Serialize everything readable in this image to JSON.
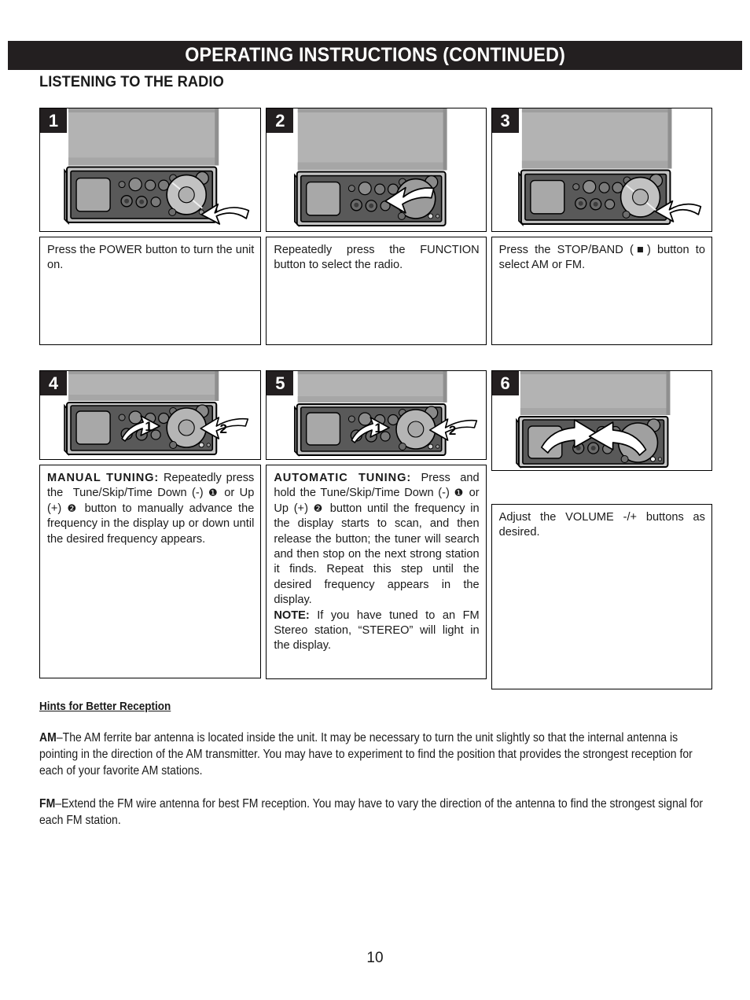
{
  "header": {
    "title": "OPERATING INSTRUCTIONS (CONTINUED)"
  },
  "section": {
    "heading": "LISTENING TO THE RADIO"
  },
  "steps": [
    {
      "number": "1",
      "figure": "stereo-front-panel-power-arrow",
      "text_plain": "Press the POWER button to turn the unit on.",
      "text_html": "Press the POWER button to turn the unit on."
    },
    {
      "number": "2",
      "figure": "stereo-front-panel-function-arrow",
      "text_plain": "Repeatedly press the FUNCTION button to select the radio.",
      "text_html": "Repeatedly press the FUNCTION button to select the radio."
    },
    {
      "number": "3",
      "figure": "stereo-front-panel-stop-band-arrow",
      "text_plain": "Press the STOP/BAND (■) button to select AM or FM.",
      "text_html": "Press the STOP/BAND (■) button to select AM or FM."
    },
    {
      "number": "4",
      "figure": "stereo-front-panel-tune-arrows-1-2",
      "text_plain": "MANUAL TUNING: Repeatedly press the  Tune/Skip/Time Down (-) ❶ or Up (+) ❷ button to manually advance the frequency in the display up or down until the desired frequency appears.",
      "text_html": "<b class=\"wide\">MANUAL TUNING:</b> Repeatedly press the&nbsp; Tune/Skip/Time Down (-) <span class=\"circ-num\">❶</span> or Up (+) <span class=\"circ-num\">❷</span> button to manually advance the frequency in the display up or down until the desired frequency appears."
    },
    {
      "number": "5",
      "figure": "stereo-front-panel-tune-arrows-1-2",
      "text_plain": "AUTOMATIC TUNING: Press and hold the Tune/Skip/Time Down (-) ❶ or Up (+) ❷ button until the frequency in the display starts to scan, and then release the button; the tuner will search and then stop on the next strong station it finds. Repeat this step until the desired frequency appears in the display. NOTE: If you have tuned to an FM Stereo station, “STEREO” will light in the display.",
      "text_html": "<b class=\"wide\">AUTOMATIC TUNING:</b> Press and hold the Tune/Skip/Time Down (-) <span class=\"circ-num\">❶</span> or Up (+) <span class=\"circ-num\">❷</span> button until the frequency in the display starts to scan, and then release the button; the tuner will search and then stop on the next strong station it finds. Repeat this step until the desired frequency appears in the display.<br><b>NOTE:</b> If you have tuned to an FM Stereo station, “STEREO” will light in the display."
    },
    {
      "number": "6",
      "figure": "stereo-front-panel-volume-arrows",
      "text_plain": "Adjust the VOLUME -/+ buttons as desired.",
      "text_html": "Adjust the VOLUME -/+ buttons as desired."
    }
  ],
  "hints": {
    "title": "Hints for Better Reception",
    "paragraphs": [
      {
        "label": "AM",
        "text_html": "<b>AM</b>–The AM ferrite bar antenna is located inside the unit. It may be necessary to turn the unit slightly so that the internal antenna is pointing in the direction of the AM transmitter. You may have to experiment to find the position that provides the strongest reception for each of your favorite AM stations.",
        "text_plain": "AM–The AM ferrite bar antenna is located inside the unit. It may be necessary to turn the unit slightly so that the internal antenna is pointing in the direction of the AM transmitter. You may have to experiment to find the position that provides the strongest reception for each of your favorite AM stations."
      },
      {
        "label": "FM",
        "text_html": "<b>FM</b>–Extend the FM wire antenna for best FM reception. You may have to vary the direction of the antenna to find the strongest signal for each FM station.",
        "text_plain": "FM–Extend the FM wire antenna for best FM reception. You may have to vary the direction of the antenna to find the strongest signal for each FM station."
      }
    ]
  },
  "footer": {
    "page_number": "10"
  },
  "colors": {
    "header_bar": "#231f20",
    "badge": "#231f20",
    "text": "#1a1a1a",
    "device_body_light": "#b3b3b3",
    "device_body_mid": "#9a9a9a",
    "device_panel_dark": "#595959",
    "device_panel_darker": "#4a4a4a",
    "knob_light": "#c9c9c9",
    "arrow_fill": "#ffffff",
    "outline": "#000000"
  }
}
